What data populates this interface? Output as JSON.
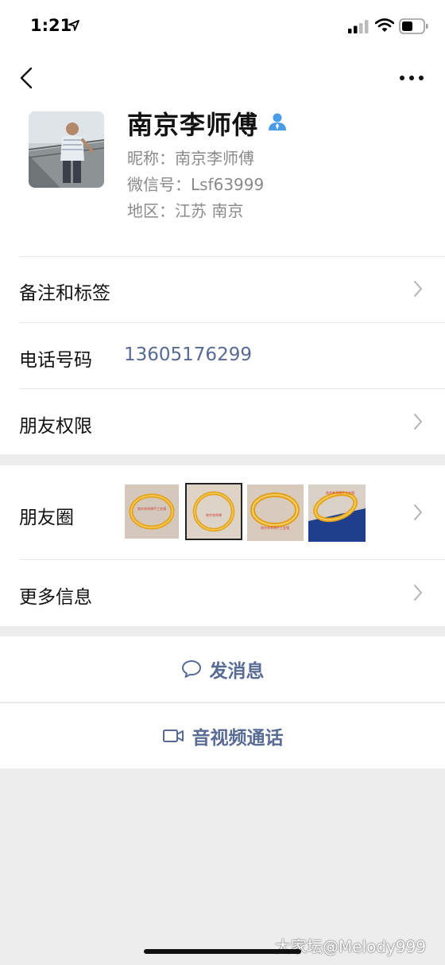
{
  "status_bar": {
    "time": "1:21"
  },
  "profile": {
    "name": "南京李师傅",
    "nickname": "昵称：南京李师傅",
    "wechat_id": "微信号：Lsf63999",
    "region": "地区：江苏 南京"
  },
  "rows": {
    "remark_tags": {
      "label": "备注和标签"
    },
    "phone": {
      "label": "电话号码",
      "value": "13605176299"
    },
    "permissions": {
      "label": "朋友权限"
    },
    "moments": {
      "label": "朋友圈"
    },
    "more_info": {
      "label": "更多信息"
    }
  },
  "actions": {
    "message": "发消息",
    "video_call": "音视频通话"
  },
  "watermark": "大家坛@Melody999",
  "colors": {
    "link_blue": "#576b95",
    "badge_blue": "#4a9be8",
    "background": "#ededed"
  }
}
